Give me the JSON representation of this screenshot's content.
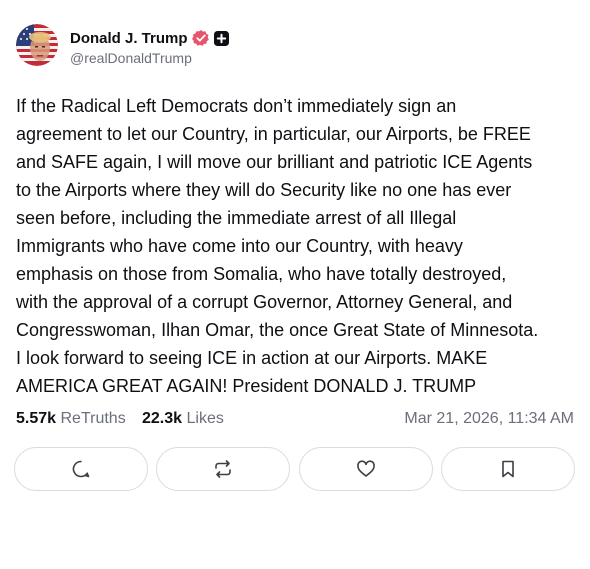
{
  "author": {
    "display_name": "Donald J. Trump",
    "handle": "@realDonaldTrump",
    "avatar_icon": "avatar-american-flag-portrait",
    "verified_icon": "verified-badge-icon",
    "plus_icon": "plus-badge-icon",
    "verified_color": "#e8546a"
  },
  "post": {
    "text": "If the Radical Left Democrats don’t immediately sign an\nagreement to let our Country, in particular, our Airports, be FREE\nand SAFE again, I will move our brilliant and patriotic ICE Agents\nto the Airports where they will do Security like no one has ever\nseen before, including the immediate arrest of all Illegal\nImmigrants who have come into our Country, with heavy\nemphasis on those from Somalia, who have totally destroyed,\nwith the approval of a corrupt Governor, Attorney General, and\nCongresswoman, Ilhan Omar, the once Great State of Minnesota.\nI look forward to seeing ICE in action at our Airports. MAKE\nAMERICA GREAT AGAIN! President DONALD J. TRUMP"
  },
  "stats": {
    "retruths_count": "5.57k",
    "retruths_label": "ReTruths",
    "likes_count": "22.3k",
    "likes_label": "Likes",
    "timestamp": "Mar 21, 2026, 11:34 AM"
  },
  "actions": [
    {
      "name": "reply",
      "icon": "reply-icon"
    },
    {
      "name": "retruth",
      "icon": "retruth-icon"
    },
    {
      "name": "like",
      "icon": "heart-icon"
    },
    {
      "name": "bookmark",
      "icon": "bookmark-icon"
    }
  ],
  "colors": {
    "text": "#0f0f14",
    "muted": "#6b6f7c",
    "border": "#d9dbe0",
    "icon": "#3d3f47"
  }
}
